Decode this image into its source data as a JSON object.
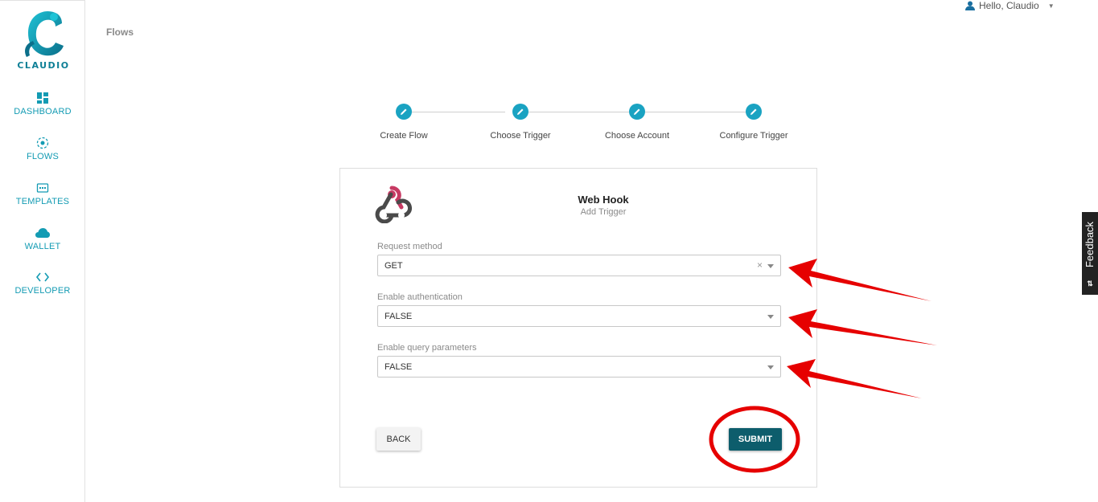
{
  "brand": {
    "name": "CLAUDIO",
    "color": "#0e7f96"
  },
  "sidebar": {
    "items": [
      {
        "label": "DASHBOARD",
        "icon": "dashboard-icon"
      },
      {
        "label": "FLOWS",
        "icon": "flows-icon"
      },
      {
        "label": "TEMPLATES",
        "icon": "templates-icon"
      },
      {
        "label": "WALLET",
        "icon": "cloud-icon"
      },
      {
        "label": "DEVELOPER",
        "icon": "code-icon"
      }
    ]
  },
  "header": {
    "breadcrumb": "Flows",
    "user_greeting": "Hello, Claudio"
  },
  "stepper": {
    "steps": [
      {
        "label": "Create Flow"
      },
      {
        "label": "Choose Trigger"
      },
      {
        "label": "Choose Account"
      },
      {
        "label": "Configure Trigger"
      }
    ]
  },
  "card": {
    "title": "Web Hook",
    "subtitle": "Add Trigger",
    "fields": [
      {
        "label": "Request method",
        "value": "GET"
      },
      {
        "label": "Enable authentication",
        "value": "FALSE"
      },
      {
        "label": "Enable query parameters",
        "value": "FALSE"
      }
    ],
    "back_label": "BACK",
    "submit_label": "SUBMIT"
  },
  "feedback": {
    "label": "Feedback"
  },
  "colors": {
    "accent": "#1aa3c2",
    "submit": "#0d5d6c",
    "annotation": "#e60000"
  }
}
